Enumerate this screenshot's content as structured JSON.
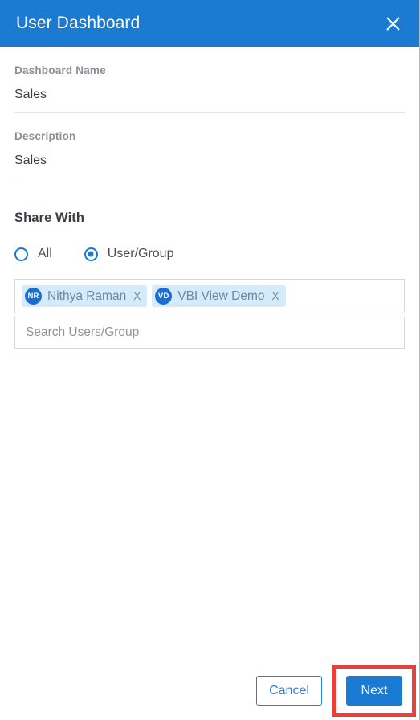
{
  "header": {
    "title": "User Dashboard",
    "close_icon": "close-icon"
  },
  "form": {
    "dashboard_name": {
      "label": "Dashboard Name",
      "value": "Sales"
    },
    "description": {
      "label": "Description",
      "value": "Sales"
    }
  },
  "share": {
    "section_title": "Share With",
    "options": [
      {
        "label": "All",
        "selected": false
      },
      {
        "label": "User/Group",
        "selected": true
      }
    ],
    "chips": [
      {
        "initials": "NR",
        "name": "Nithya Raman",
        "remove_label": "X"
      },
      {
        "initials": "VD",
        "name": "VBI View Demo",
        "remove_label": "X"
      }
    ],
    "search": {
      "placeholder": "Search Users/Group",
      "value": ""
    }
  },
  "footer": {
    "cancel_label": "Cancel",
    "next_label": "Next"
  },
  "colors": {
    "accent": "#1b7ad1",
    "highlight": "#e8413a",
    "chip_bg": "#d3ebfb",
    "avatar_bg": "#1b6fd1"
  }
}
